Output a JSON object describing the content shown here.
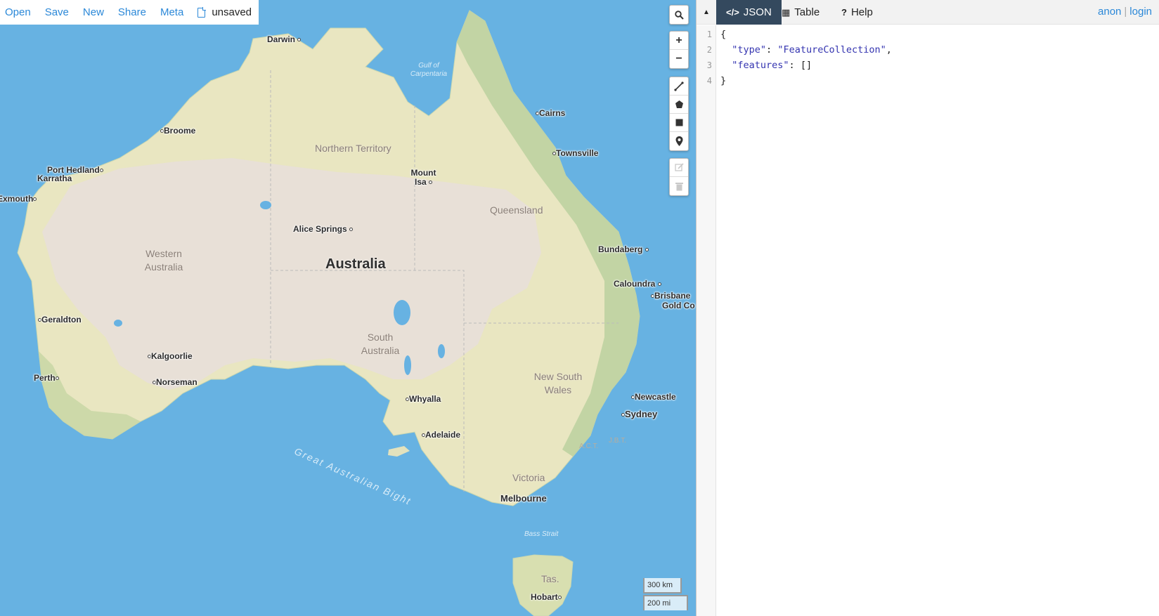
{
  "filebar": {
    "links": [
      "Open",
      "Save",
      "New",
      "Share",
      "Meta"
    ],
    "doc_status": "unsaved"
  },
  "map": {
    "country": "Australia",
    "regions": [
      "Northern Territory",
      "Queensland",
      "Western Australia",
      "South Australia",
      "New South Wales",
      "Victoria",
      "Tas."
    ],
    "cities": [
      "Darwin",
      "Cairns",
      "Broome",
      "Townsville",
      "Port Hedland",
      "Karratha",
      "Exmouth",
      "Mount Isa",
      "Alice Springs",
      "Bundaberg",
      "Caloundra",
      "Brisbane",
      "Gold Co",
      "Geraldton",
      "Kalgoorlie",
      "Perth",
      "Norseman",
      "Whyalla",
      "Newcastle",
      "Sydney",
      "Adelaide",
      "Melbourne",
      "Hobart"
    ],
    "water": [
      "Gulf of Carpentaria",
      "Great Australian Bight",
      "Bass Strait"
    ],
    "minor_label": "A.C.T.",
    "minor_label2": "J.B.T."
  },
  "controls": {
    "search": "search-icon",
    "zoom_in": "+",
    "zoom_out": "−",
    "draw_tools": [
      "line-icon",
      "polygon-icon",
      "rectangle-icon",
      "marker-icon"
    ],
    "edit_tools": [
      "edit-icon",
      "trash-icon"
    ]
  },
  "scale": {
    "metric": "300 km",
    "imperial": "200 mi"
  },
  "panel": {
    "tabs": [
      {
        "icon": "</>",
        "label": "JSON"
      },
      {
        "icon": "▦",
        "label": "Table"
      },
      {
        "icon": "?",
        "label": "Help"
      }
    ],
    "user": "anon",
    "login": "login"
  },
  "editor": {
    "line_numbers": [
      "1",
      "2",
      "3",
      "4"
    ],
    "open_brace": "{",
    "type_key": "\"type\"",
    "type_value": "\"FeatureCollection\"",
    "features_key": "\"features\"",
    "features_value": "[]",
    "close_brace": "}"
  },
  "colors": {
    "water": "#67b2e2",
    "land": "#e9e6c1",
    "desert": "#e8dfd9",
    "active_tab": "#34495e",
    "link": "#2b88d8"
  }
}
